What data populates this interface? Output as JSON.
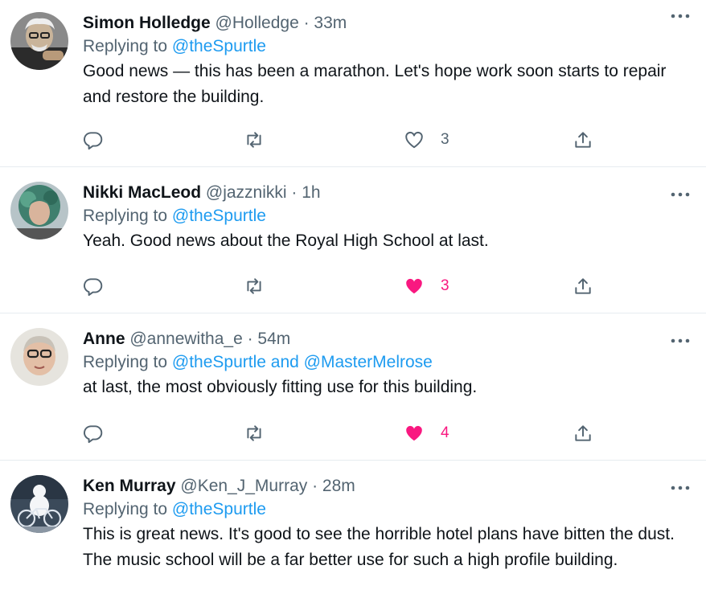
{
  "colors": {
    "accent": "#1d9bf0",
    "like": "#f91880",
    "muted": "#536471",
    "text": "#0f1419"
  },
  "tweets": [
    {
      "name": "Simon Holledge",
      "handle": "@Holledge",
      "time": "· 33m",
      "replying_prefix": "Replying to",
      "replying_to": "@theSpurtle",
      "text": "Good news — this has been a marathon. Let's hope work soon starts to repair and restore the building.",
      "likes": "3",
      "liked": false,
      "icons": [
        "reply-icon",
        "retweet-icon",
        "heart-outline-icon",
        "share-icon",
        "more-icon"
      ]
    },
    {
      "name": "Nikki MacLeod",
      "handle": "@jazznikki",
      "time": "· 1h",
      "replying_prefix": "Replying to",
      "replying_to": "@theSpurtle",
      "text": "Yeah. Good news about the Royal High School at last.",
      "likes": "3",
      "liked": true,
      "icons": [
        "reply-icon",
        "retweet-icon",
        "heart-filled-icon",
        "share-icon",
        "more-icon"
      ]
    },
    {
      "name": "Anne",
      "handle": "@annewitha_e",
      "time": "· 54m",
      "replying_prefix": "Replying to",
      "replying_to": "@theSpurtle and @MasterMelrose",
      "text": "at last, the most obviously fitting use for this building.",
      "likes": "4",
      "liked": true,
      "icons": [
        "reply-icon",
        "retweet-icon",
        "heart-filled-icon",
        "share-icon",
        "more-icon"
      ]
    },
    {
      "name": "Ken Murray",
      "handle": "@Ken_J_Murray",
      "time": "· 28m",
      "replying_prefix": "Replying to",
      "replying_to": "@theSpurtle",
      "text": "This is great news. It's good to see the horrible hotel plans have bitten the dust. The music school will be a far better use for such a high profile building.",
      "icons": [
        "more-icon"
      ]
    }
  ]
}
